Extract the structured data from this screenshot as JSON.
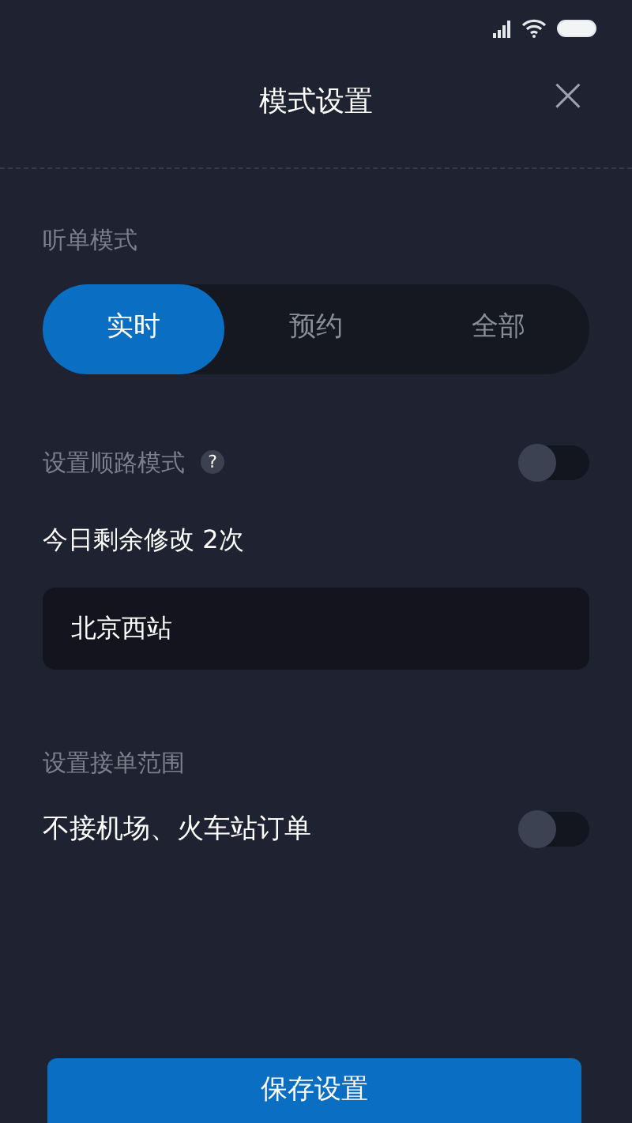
{
  "window": {
    "title": "模式设置",
    "close": "×"
  },
  "order_mode": {
    "label": "听单模式",
    "tabs": [
      {
        "label": "实时",
        "selected": true
      },
      {
        "label": "预约",
        "selected": false
      },
      {
        "label": "全部",
        "selected": false
      }
    ]
  },
  "route_mode": {
    "label": "设置顺路模式",
    "help": "?",
    "on": false
  },
  "remaining": "今日剩余修改 2次",
  "destination": {
    "value": "北京西站"
  },
  "range": {
    "label": "设置接单范围",
    "option": {
      "label": "不接机场、火车站订单",
      "on": false
    }
  },
  "save_button": "保存设置"
}
